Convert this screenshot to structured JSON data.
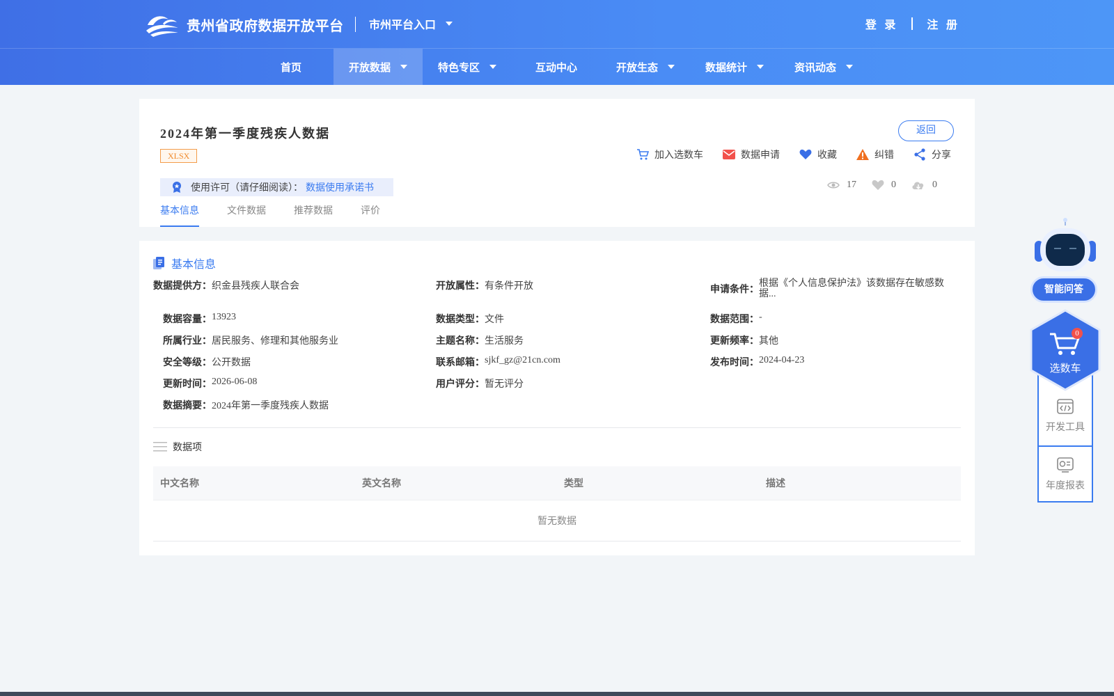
{
  "header": {
    "site_title": "贵州省政府数据开放平台",
    "city_entry": "市州平台入口",
    "login": "登 录",
    "register": "注 册"
  },
  "nav": [
    {
      "label": "首页",
      "dropdown": false,
      "active": false
    },
    {
      "label": "开放数据",
      "dropdown": true,
      "active": true
    },
    {
      "label": "特色专区",
      "dropdown": true,
      "active": false
    },
    {
      "label": "互动中心",
      "dropdown": false,
      "active": false
    },
    {
      "label": "开放生态",
      "dropdown": true,
      "active": false
    },
    {
      "label": "数据统计",
      "dropdown": true,
      "active": false
    },
    {
      "label": "资讯动态",
      "dropdown": true,
      "active": false
    }
  ],
  "dataset": {
    "title": "2024年第一季度残疾人数据",
    "format": "XLSX",
    "back": "返回",
    "actions": {
      "cart": "加入选数车",
      "apply": "数据申请",
      "favorite": "收藏",
      "report": "纠错",
      "share": "分享"
    },
    "license_label": "使用许可（请仔细阅读）：",
    "license_link": "数据使用承诺书",
    "stats": {
      "views": "17",
      "likes": "0",
      "downloads": "0"
    },
    "tabs": [
      "基本信息",
      "文件数据",
      "推荐数据",
      "评价"
    ]
  },
  "basic_info": {
    "section_title": "基本信息",
    "fields": {
      "provider": {
        "k": "数据提供方：",
        "v": "织金县残疾人联合会"
      },
      "open_attr": {
        "k": "开放属性：",
        "v": "有条件开放"
      },
      "apply_cond": {
        "k": "申请条件：",
        "v": "根据《个人信息保护法》该数据存在敏感数据..."
      },
      "capacity": {
        "k": "数据容量：",
        "v": "13923"
      },
      "data_type": {
        "k": "数据类型：",
        "v": "文件"
      },
      "data_range": {
        "k": "数据范围：",
        "v": "-"
      },
      "industry": {
        "k": "所属行业：",
        "v": "居民服务、修理和其他服务业"
      },
      "theme": {
        "k": "主题名称：",
        "v": "生活服务"
      },
      "frequency": {
        "k": "更新频率：",
        "v": "其他"
      },
      "security": {
        "k": "安全等级：",
        "v": "公开数据"
      },
      "email": {
        "k": "联系邮箱：",
        "v": "sjkf_gz@21cn.com"
      },
      "publish_time": {
        "k": "发布时间：",
        "v": "2024-04-23"
      },
      "update_time": {
        "k": "更新时间：",
        "v": "2026-06-08"
      },
      "rating": {
        "k": "用户评分：",
        "v": "暂无评分"
      },
      "summary": {
        "k": "数据摘要：",
        "v": "2024年第一季度残疾人数据"
      }
    }
  },
  "data_items": {
    "title": "数据项",
    "columns": [
      "中文名称",
      "英文名称",
      "类型",
      "描述"
    ],
    "empty": "暂无数据"
  },
  "float": {
    "ask": "智能问答",
    "cart": "选数车",
    "cart_count": "0",
    "dev_tools": "开发工具",
    "annual_report": "年度报表"
  },
  "colors": {
    "primary": "#3a7bf0",
    "header_start": "#3f6fe6",
    "header_end": "#4d96f7",
    "tag_orange": "#f08a2c"
  }
}
